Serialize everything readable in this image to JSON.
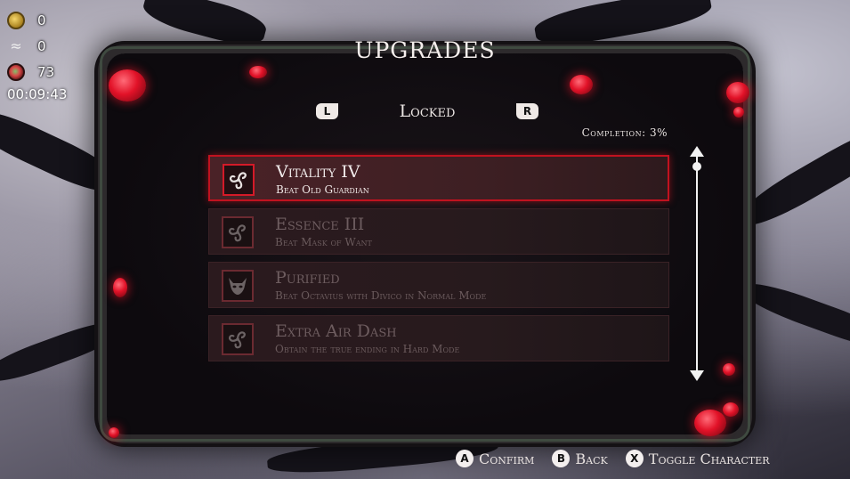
{
  "hud": {
    "coins": "0",
    "feathers": "0",
    "gems": "73",
    "timer": "00:09:43"
  },
  "title": "UPGRADES",
  "tab": {
    "left_button": "L",
    "label": "Locked",
    "right_button": "R"
  },
  "completion": "Completion:  3%",
  "upgrades": [
    {
      "name": "Vitality IV",
      "desc": "Beat Old Guardian",
      "icon": "triskelion-icon",
      "state": "selected"
    },
    {
      "name": "Essence III",
      "desc": "Beat Mask of Want",
      "icon": "triskelion-icon",
      "state": "locked"
    },
    {
      "name": "Purified",
      "desc": "Beat Octavius with Divico in Normal Mode",
      "icon": "horned-mask-icon",
      "state": "locked"
    },
    {
      "name": "Extra Air Dash",
      "desc": "Obtain the true ending in Hard Mode",
      "icon": "triskelion-icon",
      "state": "locked"
    }
  ],
  "footer": {
    "confirm_glyph": "A",
    "confirm_label": "Confirm",
    "back_glyph": "B",
    "back_label": "Back",
    "toggle_glyph": "X",
    "toggle_label": "Toggle Character"
  },
  "colors": {
    "accent_red": "#c1121f",
    "panel_bg": "#0d0a0e"
  }
}
